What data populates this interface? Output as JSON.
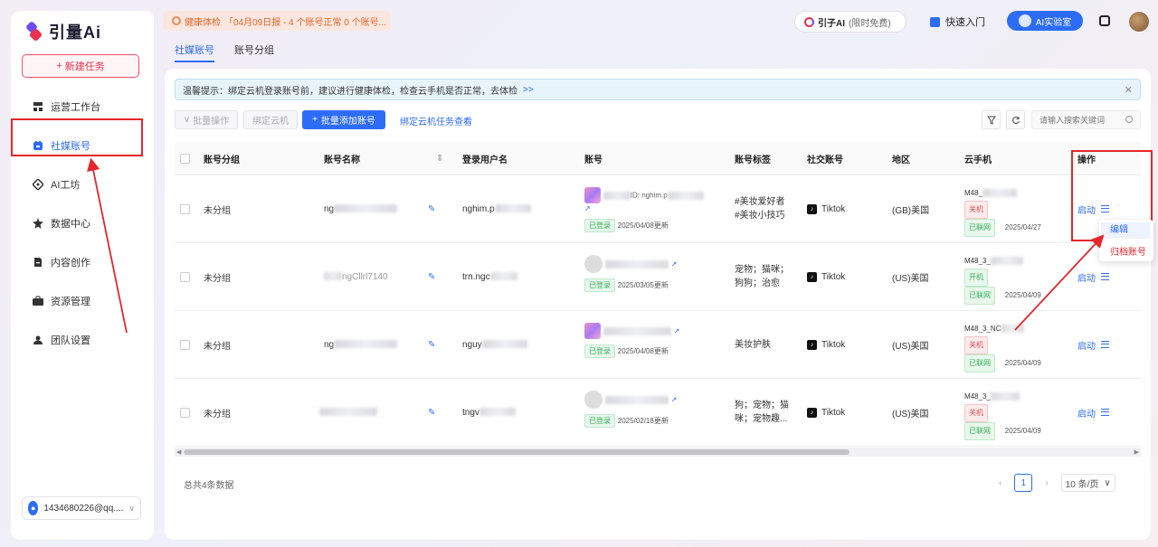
{
  "brand": {
    "name": "引量Ai"
  },
  "sidebar": {
    "new_task": "新建任务",
    "items": [
      {
        "label": "运营工作台",
        "icon": "workbench-icon"
      },
      {
        "label": "社媒账号",
        "icon": "social-account-icon",
        "active": true
      },
      {
        "label": "AI工坊",
        "icon": "ai-workshop-icon"
      },
      {
        "label": "数据中心",
        "icon": "data-center-icon"
      },
      {
        "label": "内容创作",
        "icon": "content-icon"
      },
      {
        "label": "资源管理",
        "icon": "resource-icon"
      },
      {
        "label": "团队设置",
        "icon": "team-icon"
      }
    ],
    "user": "1434680226@qq...."
  },
  "topbar": {
    "health_label": "健康体检",
    "health_text": "「04月09日报 - 4 个账号正常 0 个账号...",
    "yinzi_name": "引子AI",
    "yinzi_sub": "(限时免费)",
    "quick": "快速入门",
    "lab": "AI实验室"
  },
  "tabs": [
    "社媒账号",
    "账号分组"
  ],
  "tip": {
    "text": "温馨提示：绑定云机登录账号前，建议进行健康体检，检查云手机是否正常，去体检",
    "link": ">>"
  },
  "toolbar": {
    "batch_ops": "批量操作",
    "bind_cloud": "绑定云机",
    "batch_add": "批量添加账号",
    "bind_task": "绑定云机任务查看",
    "search_placeholder": "请输入搜索关键词"
  },
  "table": {
    "headers": [
      "账号分组",
      "账号名称",
      "登录用户名",
      "账号",
      "账号标签",
      "社交账号",
      "地区",
      "云手机",
      "操作"
    ],
    "rows": [
      {
        "group": "未分组",
        "name": "ng",
        "login": "nghim.p",
        "acc_line": "ID: nghim.p",
        "login_status": "已登录",
        "updated": "2025/04/08更新",
        "tags": [
          "#美妆爱好者",
          "#美妆小技巧"
        ],
        "social": "Tiktok",
        "region": "(GB)美国",
        "phone": "M48_",
        "power": "关机",
        "net": "已联网",
        "phone_date": "2025/04/27",
        "op": "启动"
      },
      {
        "group": "未分组",
        "name": "ngCllrl7140",
        "login": "trn.ngc",
        "acc_line": "",
        "login_status": "已登录",
        "updated": "2025/03/05更新",
        "tags": [
          "宠物；猫咪；",
          "狗狗；治愈"
        ],
        "social": "Tiktok",
        "region": "(US)美国",
        "phone": "M48_3_",
        "power": "开机",
        "net": "已联网",
        "phone_date": "2025/04/09",
        "op": "启动"
      },
      {
        "group": "未分组",
        "name": "ng",
        "login": "nguy",
        "acc_line": "",
        "login_status": "已登录",
        "updated": "2025/04/08更新",
        "tags": [
          "美妆护肤"
        ],
        "social": "Tiktok",
        "region": "(US)美国",
        "phone": "M48_3_NC",
        "power": "关机",
        "net": "已联网",
        "phone_date": "2025/04/09",
        "op": "启动"
      },
      {
        "group": "未分组",
        "name": "",
        "login": "tngv",
        "acc_line": "",
        "login_status": "已登录",
        "updated": "2025/02/18更新",
        "tags": [
          "狗；宠物；猫",
          "咪；宠物趣..."
        ],
        "social": "Tiktok",
        "region": "(US)美国",
        "phone": "M48_3_",
        "power": "关机",
        "net": "已联网",
        "phone_date": "2025/04/09",
        "op": "启动"
      }
    ]
  },
  "dropdown": {
    "edit": "编辑",
    "archive": "归档账号"
  },
  "footer": {
    "total": "总共4条数据",
    "page": "1",
    "page_size": "10 条/页"
  },
  "colors": {
    "primary": "#2d6cf6",
    "brand_red": "#e8324f",
    "annotation": "#e5262b"
  }
}
